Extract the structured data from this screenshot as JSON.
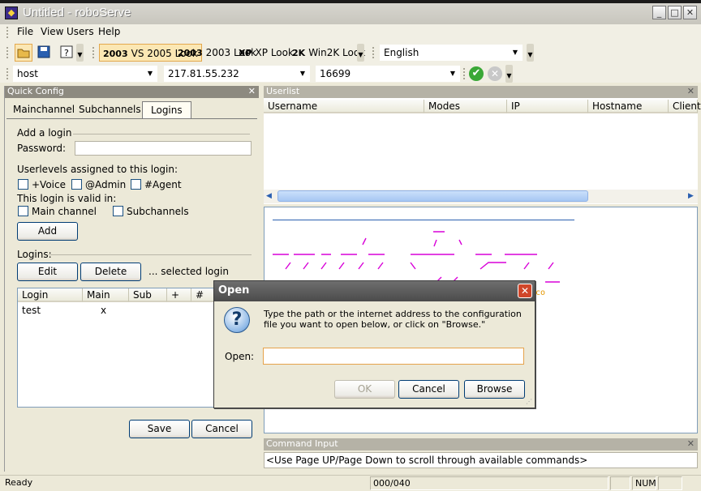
{
  "window": {
    "title": "Untitled - roboServe",
    "minimize": "_",
    "maximize": "□",
    "close": "✕"
  },
  "menu": [
    "File",
    "View",
    "Users",
    "Help"
  ],
  "toolbar": {
    "looks": [
      {
        "badge": "2003",
        "label": "VS 2005 Look",
        "active": true
      },
      {
        "badge": "2003",
        "label": "2003 Look"
      },
      {
        "badge": "XP",
        "label": "XP Look"
      },
      {
        "badge": "2K",
        "label": "Win2K Look"
      }
    ],
    "language": "English",
    "host": "host",
    "ip": "217.81.55.232",
    "port": "16699"
  },
  "quick_config": {
    "title": "Quick Config",
    "tabs": [
      "Mainchannel",
      "Subchannels",
      "Logins"
    ],
    "add_login": "Add a login",
    "password_label": "Password:",
    "userlevels_label": "Userlevels assigned to this login:",
    "levels": [
      "+Voice",
      "@Admin",
      "#Agent"
    ],
    "valid_in_label": "This login is valid in:",
    "valid_in": [
      "Main channel",
      "Subchannels"
    ],
    "add_button": "Add",
    "logins_label": "Logins:",
    "edit_button": "Edit",
    "delete_button": "Delete",
    "selected_login": "... selected login",
    "columns": [
      "Login",
      "Main",
      "Sub",
      "+",
      "#"
    ],
    "rows": [
      {
        "login": "test",
        "main": "x"
      }
    ],
    "save_button": "Save",
    "cancel_button": "Cancel"
  },
  "userlist": {
    "title": "Userlist",
    "columns": [
      "Username",
      "Modes",
      "IP",
      "Hostname",
      "Client"
    ]
  },
  "command_input": {
    "title": "Command Input",
    "hint": "<Use Page UP/Page Down to scroll through available commands>"
  },
  "statusbar": {
    "status": "Ready",
    "counter": "000/040",
    "num": "NUM"
  },
  "dialog": {
    "title": "Open",
    "message": "Type the path or the internet address to the configuration file you want to open below, or click on \"Browse.\"",
    "field_label": "Open:",
    "value": "",
    "ok": "OK",
    "cancel": "Cancel",
    "browse": "Browse"
  },
  "colors": {
    "accent": "#d800d8",
    "orange": "#e59700"
  }
}
